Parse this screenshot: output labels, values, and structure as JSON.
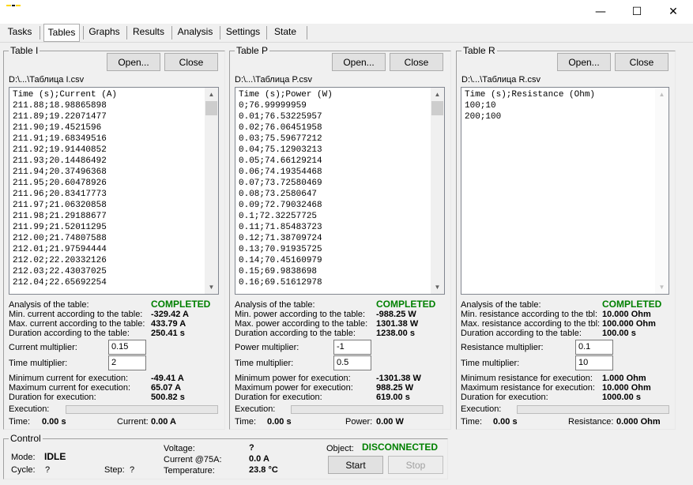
{
  "window": {
    "minimize_glyph": "—",
    "maximize_glyph": "☐",
    "close_glyph": "✕",
    "logo_colors": [
      "#ffd800",
      "#000000",
      "#ffd800"
    ]
  },
  "tabs": [
    {
      "label": "Tasks",
      "active": false
    },
    {
      "label": "Tables",
      "active": true
    },
    {
      "label": "Graphs",
      "active": false
    },
    {
      "label": "Results",
      "active": false
    },
    {
      "label": "Analysis",
      "active": false
    },
    {
      "label": "Settings",
      "active": false
    },
    {
      "label": "State",
      "active": false
    }
  ],
  "panels": [
    {
      "title": "Table I",
      "open_label": "Open...",
      "close_label": "Close",
      "path": "D:\\...\\Таблица I.csv",
      "lines": [
        "Time (s);Current (A)",
        "211.88;18.98865898",
        "211.89;19.22071477",
        "211.90;19.4521596",
        "211.91;19.68349516",
        "211.92;19.91440852",
        "211.93;20.14486492",
        "211.94;20.37496368",
        "211.95;20.60478926",
        "211.96;20.83417773",
        "211.97;21.06320858",
        "211.98;21.29188677",
        "211.99;21.52011295",
        "212.00;21.74807588",
        "212.01;21.97594444",
        "212.02;22.20332126",
        "212.03;22.43037025",
        "212.04;22.65692254"
      ],
      "scroll_thumb": true,
      "analysis_label": "Analysis of the table:",
      "analysis_status": "COMPLETED",
      "stats": [
        {
          "label": "Min. current according to the table:",
          "value": "-329.42 A"
        },
        {
          "label": "Max. current according to the table:",
          "value": "433.79 A"
        },
        {
          "label": "Duration according to the table:",
          "value": "250.41 s"
        }
      ],
      "multiplier_label": "Current multiplier:",
      "multiplier_value": "0.15",
      "time_mult_label": "Time multiplier:",
      "time_mult_value": "2",
      "exec_stats": [
        {
          "label": "Minimum current for execution:",
          "value": "-49.41 A"
        },
        {
          "label": "Maximum current for execution:",
          "value": "65.07 A"
        },
        {
          "label": "Duration for execution:",
          "value": "500.82 s"
        }
      ],
      "execution_label": "Execution:",
      "execution_progress": 0,
      "time_label": "Time:",
      "time_value": "0.00 s",
      "quantity_label": "Current:",
      "quantity_value": "0.00 A"
    },
    {
      "title": "Table P",
      "open_label": "Open...",
      "close_label": "Close",
      "path": "D:\\...\\Таблица P.csv",
      "lines": [
        "Time (s);Power (W)",
        "0;76.99999959",
        "0.01;76.53225957",
        "0.02;76.06451958",
        "0.03;75.59677212",
        "0.04;75.12903213",
        "0.05;74.66129214",
        "0.06;74.19354468",
        "0.07;73.72580469",
        "0.08;73.2580647",
        "0.09;72.79032468",
        "0.1;72.32257725",
        "0.11;71.85483723",
        "0.12;71.38709724",
        "0.13;70.91935725",
        "0.14;70.45160979",
        "0.15;69.9838698",
        "0.16;69.51612978"
      ],
      "scroll_thumb": true,
      "analysis_label": "Analysis of the table:",
      "analysis_status": "COMPLETED",
      "stats": [
        {
          "label": "Min. power according to the table:",
          "value": "-988.25 W"
        },
        {
          "label": "Max. power according to the table:",
          "value": "1301.38 W"
        },
        {
          "label": "Duration according to the table:",
          "value": "1238.00 s"
        }
      ],
      "multiplier_label": "Power multiplier:",
      "multiplier_value": "-1",
      "time_mult_label": "Time multiplier:",
      "time_mult_value": "0.5",
      "exec_stats": [
        {
          "label": "Minimum power for execution:",
          "value": "-1301.38 W"
        },
        {
          "label": "Maximum power for execution:",
          "value": "988.25 W"
        },
        {
          "label": "Duration for execution:",
          "value": "619.00 s"
        }
      ],
      "execution_label": "Execution:",
      "execution_progress": 0,
      "time_label": "Time:",
      "time_value": "0.00 s",
      "quantity_label": "Power:",
      "quantity_value": "0.00 W"
    },
    {
      "title": "Table R",
      "open_label": "Open...",
      "close_label": "Close",
      "path": "D:\\...\\Таблица R.csv",
      "lines": [
        "Time (s);Resistance (Ohm)",
        "100;10",
        "200;100"
      ],
      "scroll_thumb": false,
      "analysis_label": "Analysis of the table:",
      "analysis_status": "COMPLETED",
      "stats": [
        {
          "label": "Min. resistance according to the tbl:",
          "value": "10.000 Ohm"
        },
        {
          "label": "Max. resistance according to the tbl:",
          "value": "100.000 Ohm"
        },
        {
          "label": "Duration according to the table:",
          "value": "100.00 s"
        }
      ],
      "multiplier_label": "Resistance multiplier:",
      "multiplier_value": "0.1",
      "time_mult_label": "Time multiplier:",
      "time_mult_value": "10",
      "exec_stats": [
        {
          "label": "Minimum resistance for execution:",
          "value": "1.000 Ohm"
        },
        {
          "label": "Maximum resistance for execution:",
          "value": "10.000 Ohm"
        },
        {
          "label": "Duration for execution:",
          "value": "1000.00 s"
        }
      ],
      "execution_label": "Execution:",
      "execution_progress": 0,
      "time_label": "Time:",
      "time_value": "0.00 s",
      "quantity_label": "Resistance:",
      "quantity_value": "0.000 Ohm"
    }
  ],
  "control": {
    "title": "Control",
    "mode_label": "Mode:",
    "mode_value": "IDLE",
    "cycle_label": "Cycle:",
    "cycle_value": "?",
    "step_label": "Step:",
    "step_value": "?",
    "voltage_label": "Voltage:",
    "voltage_value": "?",
    "current_label": "Current @75A:",
    "current_value": "0.0 A",
    "temperature_label": "Temperature:",
    "temperature_value": "23.8 °C",
    "object_label": "Object:",
    "object_value": "DISCONNECTED",
    "start_label": "Start",
    "stop_label": "Stop"
  },
  "colors": {
    "status_green": "#008000",
    "progress_fill": "#06b025"
  }
}
